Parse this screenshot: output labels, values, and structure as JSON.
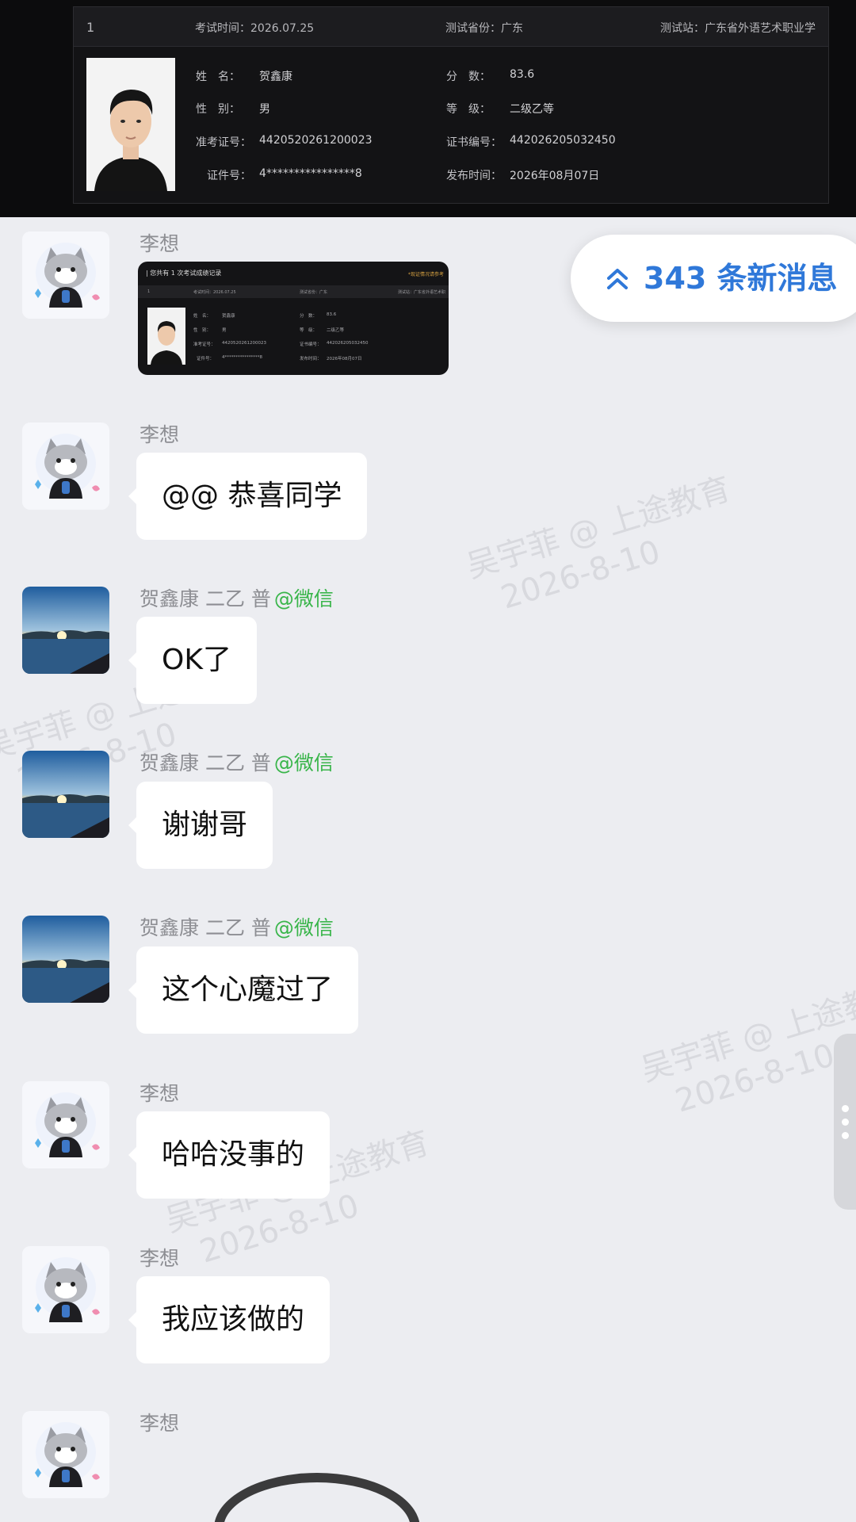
{
  "score_card": {
    "row_index": "1",
    "exam_time": "考试时间：2026.07.25",
    "exam_province": "测试省份：广东",
    "exam_site": "测试站：广东省外语艺术职业学",
    "fields": [
      {
        "key": "姓　名：",
        "value": "贺鑫康"
      },
      {
        "key": "性　别：",
        "value": "男"
      },
      {
        "key": "准考证号：",
        "value": "4420520261200023"
      },
      {
        "key": "证件号：",
        "value": "4****************8"
      },
      {
        "key": "分　数：",
        "value": "83.6"
      },
      {
        "key": "等　级：",
        "value": "二级乙等"
      },
      {
        "key": "证书编号：",
        "value": "442026205032450"
      },
      {
        "key": "发布时间：",
        "value": "2026年08月07日"
      }
    ]
  },
  "thumbnail": {
    "header": "| 您共有 1 次考试成绩记录",
    "note": "*现证情况请参考",
    "row_index": "1",
    "exam_time": "考试时间：2026.07.25",
    "exam_province": "测试省份：广东",
    "exam_site": "测试站：广东省外语艺术职"
  },
  "new_messages": {
    "label": "343 条新消息"
  },
  "messages": [
    {
      "sender": "李想",
      "tag": "",
      "text": ""
    },
    {
      "sender": "李想",
      "tag": "",
      "text": "@@ 恭喜同学"
    },
    {
      "sender": "贺鑫康 二乙 普",
      "tag": "@微信",
      "text": "OK了"
    },
    {
      "sender": "贺鑫康 二乙 普",
      "tag": "@微信",
      "text": "谢谢哥"
    },
    {
      "sender": "贺鑫康 二乙 普",
      "tag": "@微信",
      "text": "这个心魔过了"
    },
    {
      "sender": "李想",
      "tag": "",
      "text": "哈哈没事的"
    },
    {
      "sender": "李想",
      "tag": "",
      "text": "我应该做的"
    },
    {
      "sender": "李想",
      "tag": "",
      "text": ""
    }
  ],
  "watermarks": {
    "line1": "吴宇菲 @ 上途教育",
    "line2": "2026-8-10"
  },
  "colors": {
    "background": "#ecedf1",
    "accent_blue": "#2f78d9",
    "wechat_green": "#39b54a",
    "dark_card": "#131315"
  }
}
